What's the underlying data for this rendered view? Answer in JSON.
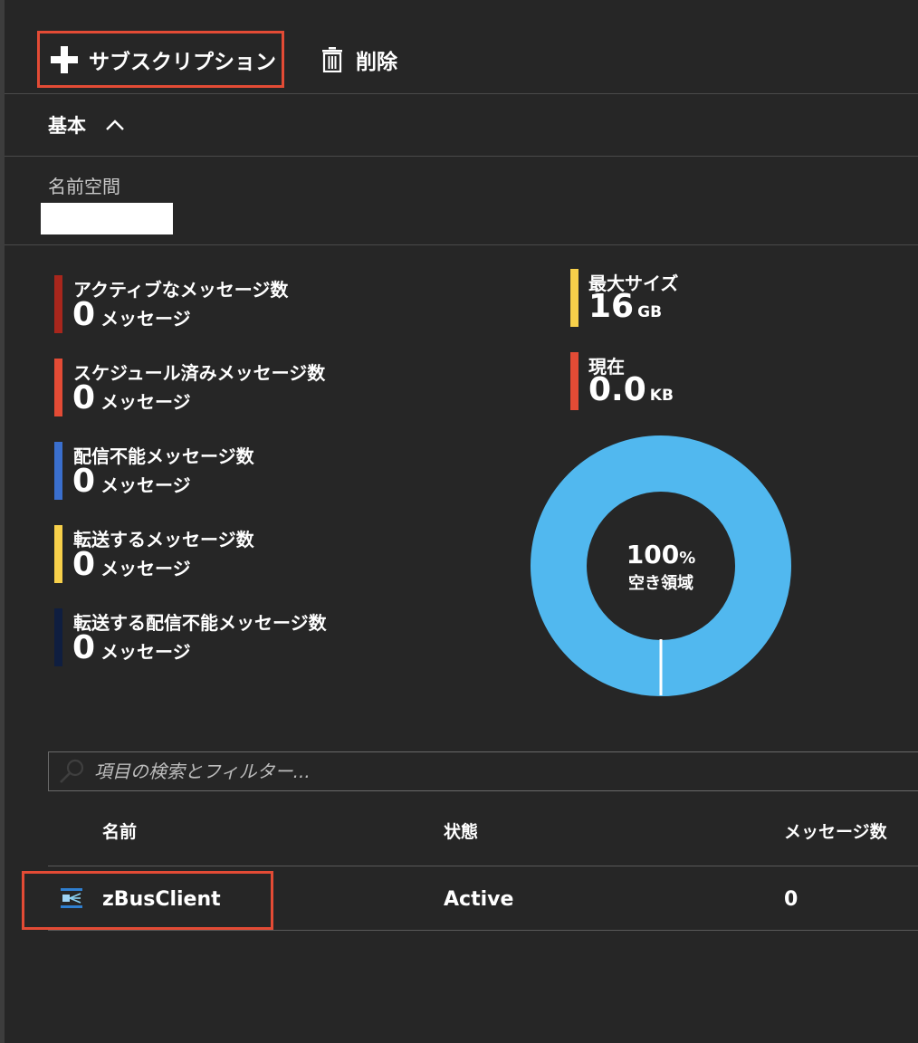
{
  "toolbar": {
    "add_subscription_label": "サブスクリプション",
    "delete_label": "削除"
  },
  "basics": {
    "title": "基本",
    "namespace_label": "名前空間",
    "namespace_value": ""
  },
  "metrics": [
    {
      "label": "アクティブなメッセージ数",
      "value": "0",
      "unit": "メッセージ",
      "color": "#a8261c"
    },
    {
      "label": "スケジュール済みメッセージ数",
      "value": "0",
      "unit": "メッセージ",
      "color": "#e34b35"
    },
    {
      "label": "配信不能メッセージ数",
      "value": "0",
      "unit": "メッセージ",
      "color": "#3a6fce"
    },
    {
      "label": "転送するメッセージ数",
      "value": "0",
      "unit": "メッセージ",
      "color": "#f7d04a"
    },
    {
      "label": "転送する配信不能メッセージ数",
      "value": "0",
      "unit": "メッセージ",
      "color": "#0f1e40"
    }
  ],
  "size": {
    "max": {
      "label": "最大サイズ",
      "value": "16",
      "unit": "GB",
      "color": "#f7d04a"
    },
    "current": {
      "label": "現在",
      "value": "0.0",
      "unit": "KB",
      "color": "#e34b35"
    }
  },
  "donut": {
    "percent_value": "100",
    "percent_sign": "%",
    "caption": "空き領域",
    "free_fraction": 1.0,
    "color": "#51b8ef"
  },
  "search": {
    "placeholder": "項目の検索とフィルター..."
  },
  "table": {
    "columns": [
      "名前",
      "状態",
      "メッセージ数"
    ],
    "rows": [
      {
        "name": "zBusClient",
        "status": "Active",
        "messages": "0"
      }
    ]
  },
  "icons": {
    "add": "plus-icon",
    "delete": "trash-icon",
    "collapse": "chevron-up-icon",
    "search": "search-icon",
    "row": "topic-icon"
  },
  "colors": {
    "highlight": "#e34b35",
    "background": "#262626"
  }
}
